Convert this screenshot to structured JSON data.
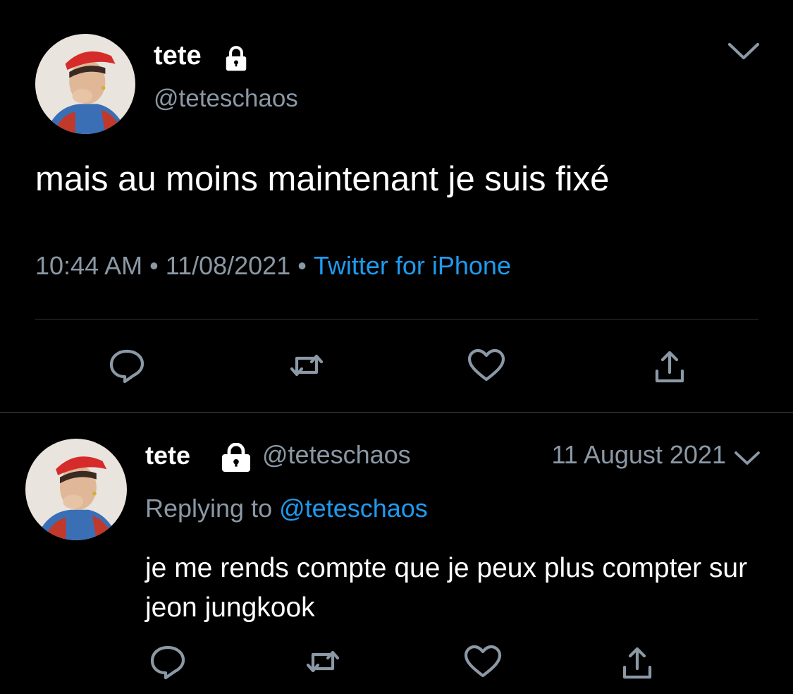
{
  "main_tweet": {
    "display_name": "tete",
    "handle": "@teteschaos",
    "text": "mais au moins maintenant je suis fixé",
    "time": "10:44 AM",
    "date": "11/08/2021",
    "source": "Twitter for iPhone",
    "separator": "•",
    "icons": {
      "lock": "lock-icon",
      "menu": "chevron-down-icon",
      "reply": "reply-icon",
      "retweet": "retweet-icon",
      "like": "heart-icon",
      "share": "share-icon"
    }
  },
  "reply_tweet": {
    "display_name": "tete",
    "handle": "@teteschaos",
    "date": "11 August 2021",
    "replying_prefix": "Replying to",
    "replying_mention": "@teteschaos",
    "text": "je me rends compte que je peux plus compter sur jeon jungkook"
  },
  "colors": {
    "background": "#000000",
    "primary_text": "#ffffff",
    "secondary_text": "#8b98a5",
    "accent": "#1d9bf0",
    "divider": "#2f3336"
  }
}
